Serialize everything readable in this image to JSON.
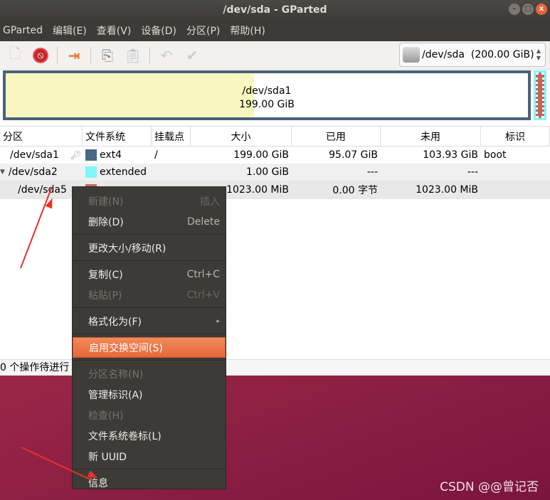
{
  "window": {
    "title": "/dev/sda - GParted"
  },
  "menubar": [
    "GParted",
    "编辑(E)",
    "查看(V)",
    "设备(D)",
    "分区(P)",
    "帮助(H)"
  ],
  "device_selector": {
    "value": "/dev/sda  (200.00 GiB)"
  },
  "diskmap": {
    "label": "/dev/sda1",
    "size": "199.00 GiB",
    "used_fraction": 0.475
  },
  "table": {
    "headers": [
      "分区",
      "文件系统",
      "挂载点",
      "大小",
      "已用",
      "未用",
      "标识"
    ],
    "rows": [
      {
        "partition": "/dev/sda1",
        "fs": "ext4",
        "fs_color": "#4b6983",
        "mount": "/",
        "size": "199.00 GiB",
        "used": "95.07 GiB",
        "unused": "103.93 GiB",
        "flags": "boot"
      },
      {
        "partition": "/dev/sda2",
        "fs": "extended",
        "fs_color": "#7ef8f8",
        "mount": "",
        "size": "1.00 GiB",
        "used": "---",
        "unused": "---",
        "flags": ""
      },
      {
        "partition": "/dev/sda5",
        "fs": "",
        "fs_color": "#c1665a",
        "mount": "",
        "size": "1023.00 MiB",
        "used": "0.00 字节",
        "unused": "1023.00 MiB",
        "flags": ""
      }
    ]
  },
  "status": "0 个操作待进行",
  "context_menu": [
    {
      "label": "新建(N)",
      "accel": "插入"
    },
    {
      "label": "删除(D)",
      "accel": "Delete"
    },
    {
      "label": "更改大小/移动(R)",
      "accel": ""
    },
    {
      "label": "复制(C)",
      "accel": "Ctrl+C"
    },
    {
      "label": "粘贴(P)",
      "accel": "Ctrl+V"
    },
    {
      "label": "格式化为(F)",
      "accel": "▸"
    },
    {
      "label": "启用交换空间(S)",
      "accel": ""
    },
    {
      "label": "分区名称(N)",
      "accel": ""
    },
    {
      "label": "管理标识(A)",
      "accel": ""
    },
    {
      "label": "检查(H)",
      "accel": ""
    },
    {
      "label": "文件系统卷标(L)",
      "accel": ""
    },
    {
      "label": "新 UUID",
      "accel": ""
    },
    {
      "label": "信息",
      "accel": ""
    }
  ],
  "watermark": "CSDN @@曾记否"
}
